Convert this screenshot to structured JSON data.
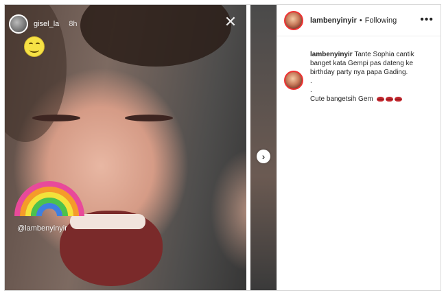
{
  "story": {
    "username": "gisel_la",
    "time": "8h",
    "watermark": "@lambenyinyir",
    "close_icon": "close-icon",
    "next_icon": "chevron-right-icon"
  },
  "post": {
    "author": "lambenyinyir",
    "separator": "•",
    "follow_status": "Following",
    "more_icon": "more-horizontal-icon",
    "caption_user": "lambenyinyir",
    "caption_line1": "Tante Sophia cantik banget kata Gempi pas dateng ke birthday party nya papa Gading.",
    "caption_dot1": ".",
    "caption_dot2": ".",
    "caption_line2": "Cute bangetsih Gem",
    "emoji": "lips-emoji",
    "emoji_count": 3
  }
}
